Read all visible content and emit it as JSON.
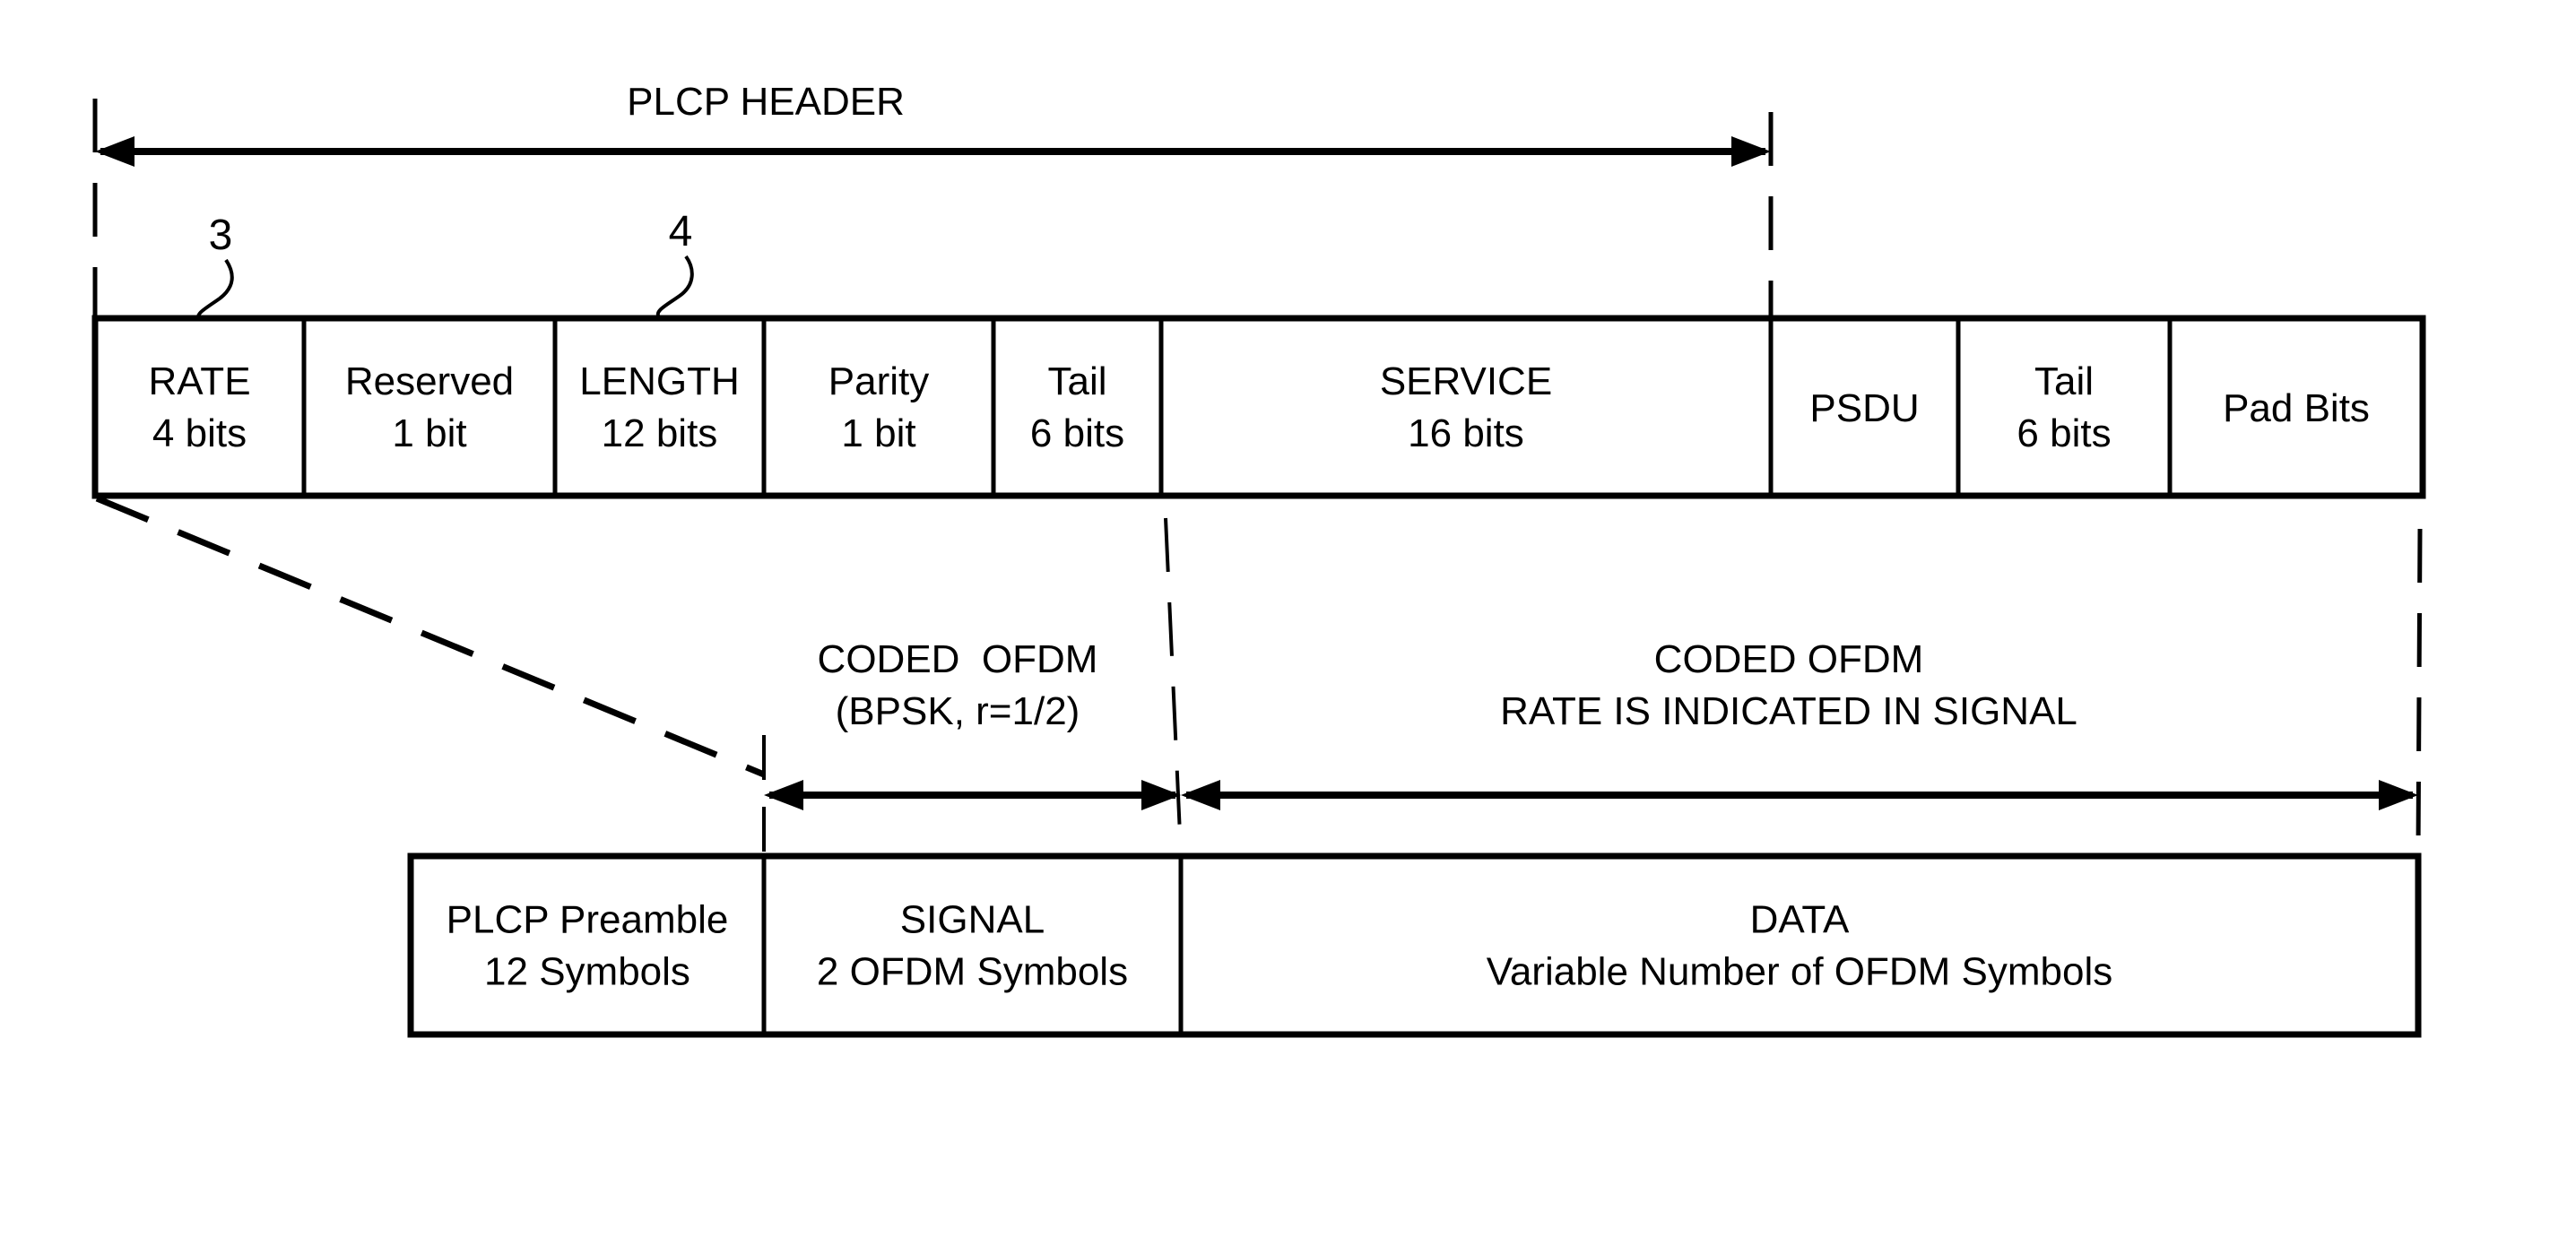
{
  "diagram": {
    "plcp_header_label": "PLCP HEADER",
    "reference_numerals": [
      "3",
      "4"
    ],
    "top_fields": [
      {
        "name": "RATE",
        "size": "4 bits"
      },
      {
        "name": "Reserved",
        "size": "1 bit"
      },
      {
        "name": "LENGTH",
        "size": "12 bits"
      },
      {
        "name": "Parity",
        "size": "1 bit"
      },
      {
        "name": "Tail",
        "size": "6 bits"
      },
      {
        "name": "SERVICE",
        "size": "16 bits"
      },
      {
        "name": "PSDU",
        "size": ""
      },
      {
        "name": "Tail",
        "size": "6 bits"
      },
      {
        "name": "Pad Bits",
        "size": ""
      }
    ],
    "signal_coding": {
      "line1": "CODED  OFDM",
      "line2": "(BPSK, r=1/2)"
    },
    "data_coding": {
      "line1": "CODED OFDM",
      "line2": "RATE IS INDICATED IN SIGNAL"
    },
    "bottom_fields": [
      {
        "name": "PLCP Preamble",
        "size": "12 Symbols"
      },
      {
        "name": "SIGNAL",
        "size": "2 OFDM Symbols"
      },
      {
        "name": "DATA",
        "size": "Variable Number of OFDM Symbols"
      }
    ]
  }
}
